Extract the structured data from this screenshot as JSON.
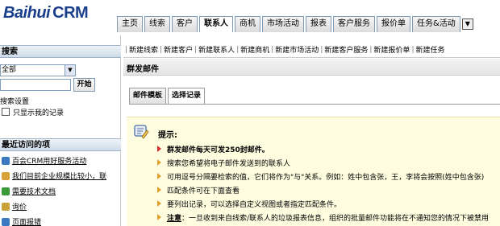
{
  "header": {
    "logo_part1": "Baihui",
    "logo_part2": "CRM",
    "tabs": [
      {
        "label": "主页"
      },
      {
        "label": "线索"
      },
      {
        "label": "客户"
      },
      {
        "label": "联系人",
        "active": true
      },
      {
        "label": "商机"
      },
      {
        "label": "市场活动"
      },
      {
        "label": "报表"
      },
      {
        "label": "客户服务"
      },
      {
        "label": "报价单"
      },
      {
        "label": "任务&活动"
      }
    ]
  },
  "sidebar": {
    "search_title": "搜索",
    "search_scope": "全部",
    "search_value": "",
    "go_button": "开始",
    "search_settings": "搜索设置",
    "only_mine_label": "只显示我的记录",
    "recent_title": "最近访问的项",
    "recent_items": [
      {
        "label": "百会CRM用好服务活动",
        "color": "#3a78c2"
      },
      {
        "label": "我们目前企业规模比较小，联",
        "color": "#d9a33a"
      },
      {
        "label": "需要技术文档",
        "color": "#3a9a3a"
      },
      {
        "label": "询价",
        "color": "#c9a23a"
      },
      {
        "label": "页面报错",
        "color": "#3a78c2"
      }
    ]
  },
  "subnav": {
    "items": [
      "新建线索",
      "新建客户",
      "新建联系人",
      "新建商机",
      "新建市场活动",
      "新建客户服务",
      "新建报价单",
      "新建任务"
    ]
  },
  "main": {
    "page_title": "群发邮件",
    "inner_tabs": [
      {
        "label": "邮件模板"
      },
      {
        "label": "选择记录",
        "active": true
      }
    ],
    "tips_title": "提示:",
    "tips": [
      {
        "text": "群发邮件每天可发250封邮件。",
        "bold": true,
        "red": true
      },
      {
        "text": "搜索您希望将电子邮件发送到的联系人"
      },
      {
        "text": "可用逗号分隔要检索的值，它们将作为\"与\"关系。例如：姓中包含张，王，李将会按照(姓中包含张)"
      },
      {
        "text": "匹配条件可在下面查看"
      },
      {
        "text": "要列出记录，可以选择自定义视图或者指定匹配条件。"
      },
      {
        "note_label": "注意",
        "text": "：一旦收到来自线索/联系人的垃圾报表信息，组织的批量邮件功能将在不通知您的情况下被禁用"
      }
    ]
  }
}
